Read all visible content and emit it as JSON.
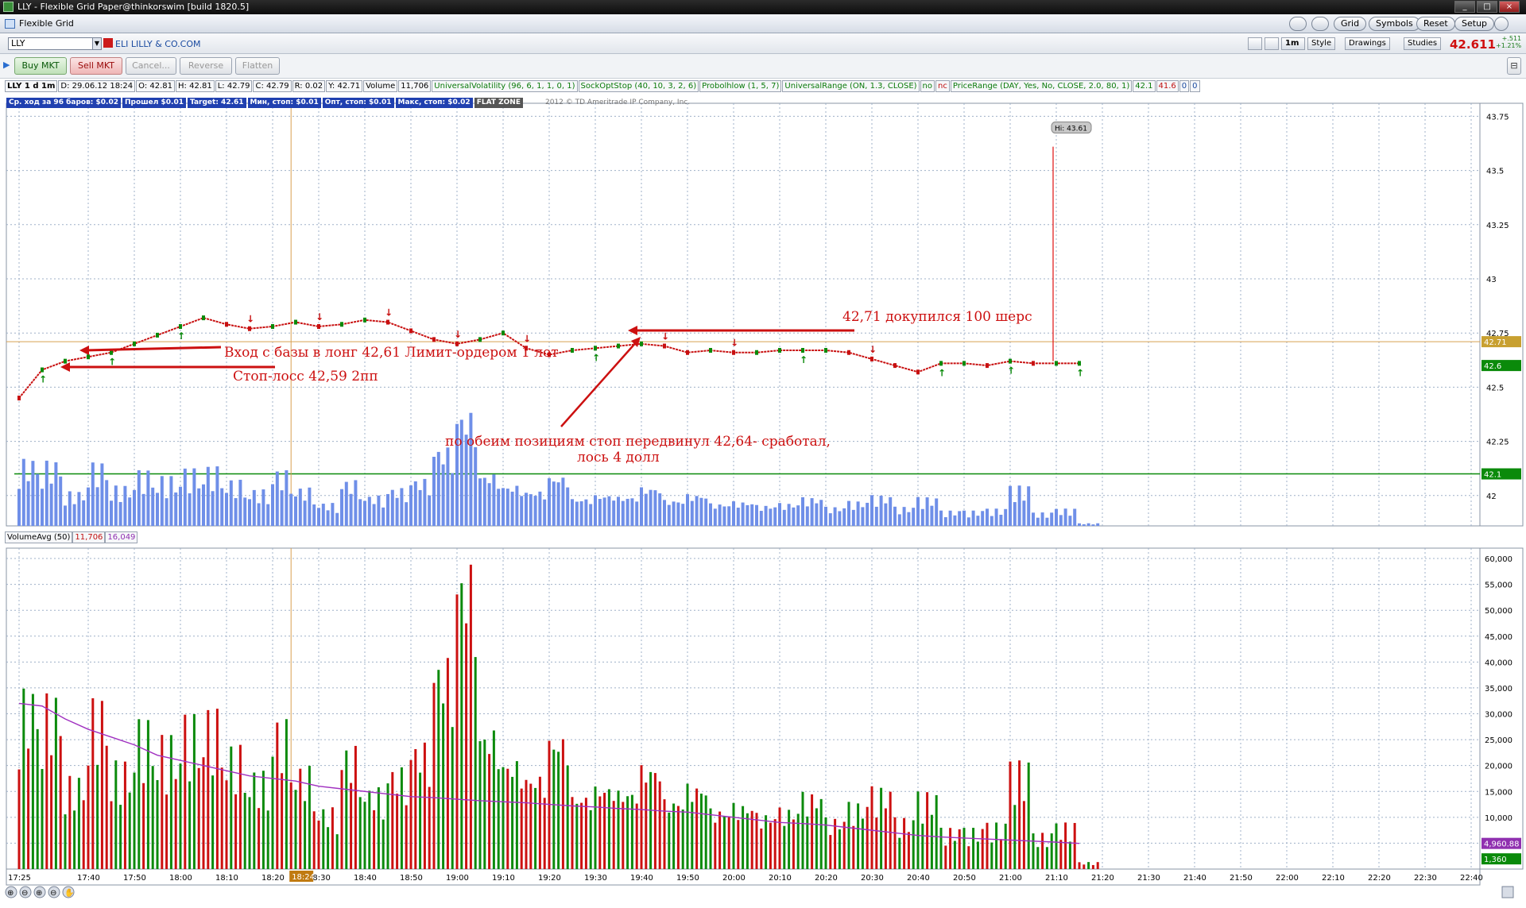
{
  "window": {
    "title": "LLY - Flexible Grid Paper@thinkorswim [build 1820.5]"
  },
  "menubar": {
    "tab_label": "Flexible Grid",
    "buttons": [
      "Grid",
      "Symbols",
      "Reset",
      "Setup"
    ]
  },
  "symbol_bar": {
    "symbol": "LLY",
    "company": "ELI LILLY & CO.COM",
    "timeframe": "1m",
    "tools": [
      "Style",
      "Drawings",
      "Studies"
    ],
    "last_price": "42.611",
    "change_top": "+.511",
    "change_bottom": "+1.21%"
  },
  "order_bar": {
    "buttons": [
      "Buy MKT",
      "Sell MKT",
      "Cancel...",
      "Reverse",
      "Flatten"
    ]
  },
  "legend": {
    "items": [
      "LLY 1 d 1m",
      "D: 29.06.12 18:24",
      "O: 42.81",
      "H: 42.81",
      "L: 42.79",
      "C: 42.79",
      "R: 0.02",
      "Y: 42.71",
      "Volume",
      "11,706",
      "UniversalVolatility (96, 6, 1, 1, 0, 1)",
      "SockOptStop (40, 10, 3, 2, 6)",
      "Probolhlow (1, 5, 7)",
      "UniversalRange (ON, 1.3, CLOSE)",
      "no",
      "nc",
      "PriceRange (DAY, Yes, No, CLOSE, 2.0, 80, 1)",
      "42.1",
      "41.6",
      "0",
      "0"
    ]
  },
  "stat_bar": {
    "items": [
      "Ср. ход за 96 баров: $0.02",
      "Прошел $0.01",
      "Target: 42.61",
      "Мин, стоп: $0.01",
      "Опт, стоп: $0.01",
      "Макс, стоп: $0.02"
    ],
    "flat_zone": "FLAT ZONE",
    "copyright": "2012 © TD Ameritrade IP Company, Inc."
  },
  "annotations": {
    "entry": "Вход с базы в лонг 42,61 Лимит-ордером 1 лот",
    "stop": "Стоп-лосс 42,59 2пп",
    "added": "42,71 докупился 100 шерс",
    "moved_stop_line1": "по обеим позициям стоп передвинул 42,64- сработал,",
    "moved_stop_line2": "лось 4 долл",
    "hi_label": "Hi: 43.61"
  },
  "price_axis": {
    "ticks": [
      "43.75",
      "43.5",
      "43.25",
      "43",
      "42.75",
      "42.5",
      "42.25",
      "42"
    ],
    "markers": {
      "line_4271": "42.71",
      "last": "42.6",
      "line_421": "42.1"
    }
  },
  "volume_legend": {
    "name": "VolumeAvg (50)",
    "volume": "11,706",
    "avg": "16,049"
  },
  "volume_axis": {
    "ticks": [
      "60,000",
      "55,000",
      "50,000",
      "45,000",
      "40,000",
      "35,000",
      "30,000",
      "25,000",
      "20,000",
      "15,000",
      "10,000",
      "5,000"
    ],
    "markers": {
      "avg": "4,960.88",
      "vol": "1,360"
    }
  },
  "time_axis": {
    "ticks": [
      "17:25",
      "17:40",
      "17:50",
      "18:00",
      "18:10",
      "18:20",
      "18:30",
      "18:40",
      "18:50",
      "19:00",
      "19:10",
      "19:20",
      "19:30",
      "19:40",
      "19:50",
      "20:00",
      "20:10",
      "20:20",
      "20:30",
      "20:40",
      "20:50",
      "21:00",
      "21:10",
      "21:20",
      "21:30",
      "21:40",
      "21:50",
      "22:00",
      "22:10",
      "22:20",
      "22:30",
      "22:40"
    ],
    "cursor": "18:24"
  },
  "chart_data": {
    "type": "line",
    "title": "LLY 1 d 1m",
    "price_series": {
      "name": "LLY",
      "x": [
        "17:25",
        "17:30",
        "17:35",
        "17:40",
        "17:45",
        "17:50",
        "17:55",
        "18:00",
        "18:05",
        "18:10",
        "18:15",
        "18:20",
        "18:25",
        "18:30",
        "18:35",
        "18:40",
        "18:45",
        "18:50",
        "18:55",
        "19:00",
        "19:05",
        "19:10",
        "19:15",
        "19:20",
        "19:25",
        "19:30",
        "19:35",
        "19:40",
        "19:45",
        "19:50",
        "19:55",
        "20:00",
        "20:05",
        "20:10",
        "20:15",
        "20:20",
        "20:25",
        "20:30",
        "20:35",
        "20:40",
        "20:45",
        "20:50",
        "20:55",
        "21:00",
        "21:05",
        "21:10",
        "21:15"
      ],
      "close": [
        42.45,
        42.58,
        42.62,
        42.64,
        42.66,
        42.7,
        42.74,
        42.78,
        42.82,
        42.79,
        42.77,
        42.78,
        42.8,
        42.78,
        42.79,
        42.81,
        42.8,
        42.76,
        42.72,
        42.7,
        42.72,
        42.75,
        42.68,
        42.65,
        42.67,
        42.68,
        42.69,
        42.7,
        42.69,
        42.66,
        42.67,
        42.66,
        42.66,
        42.67,
        42.67,
        42.67,
        42.66,
        42.63,
        42.6,
        42.57,
        42.61,
        42.61,
        42.6,
        42.62,
        42.61,
        42.61,
        42.61
      ]
    },
    "volume_series": {
      "name": "Volume",
      "x": [
        "17:25",
        "17:30",
        "17:35",
        "17:40",
        "17:45",
        "17:50",
        "17:55",
        "18:00",
        "18:05",
        "18:10",
        "18:15",
        "18:20",
        "18:25",
        "18:30",
        "18:35",
        "18:40",
        "18:45",
        "18:50",
        "18:55",
        "19:00",
        "19:05",
        "19:10",
        "19:15",
        "19:20",
        "19:25",
        "19:30",
        "19:35",
        "19:40",
        "19:45",
        "19:50",
        "19:55",
        "20:00",
        "20:05",
        "20:10",
        "20:15",
        "20:20",
        "20:25",
        "20:30",
        "20:35",
        "20:40",
        "20:45",
        "20:50",
        "20:55",
        "21:00",
        "21:05",
        "21:10",
        "21:15"
      ],
      "values": [
        35000,
        34000,
        18000,
        33000,
        21000,
        29000,
        26000,
        30000,
        31000,
        24000,
        19000,
        29000,
        20000,
        12000,
        24000,
        16000,
        20000,
        25000,
        42000,
        61000,
        28000,
        22000,
        19000,
        27000,
        15000,
        17000,
        16000,
        21000,
        14000,
        17000,
        12000,
        13000,
        11000,
        12000,
        15000,
        10000,
        13000,
        16000,
        10000,
        15000,
        8000,
        8000,
        9000,
        21000,
        7000,
        9000,
        1360
      ]
    },
    "volume_avg": {
      "name": "VolumeAvg (50)",
      "values": [
        32000,
        31500,
        29000,
        27000,
        25500,
        24000,
        22000,
        21000,
        20000,
        19000,
        18000,
        17500,
        17000,
        16000,
        15500,
        15000,
        14500,
        14000,
        13800,
        13500,
        13200,
        13000,
        12800,
        12500,
        12200,
        12000,
        11700,
        11500,
        11200,
        11000,
        10500,
        10000,
        9500,
        9000,
        8800,
        8500,
        8000,
        7500,
        7000,
        6500,
        6200,
        6000,
        5800,
        5600,
        5400,
        5200,
        4960.88
      ]
    },
    "y_price_range": [
      41.86,
      43.81
    ],
    "y_volume_range": [
      0,
      62000
    ],
    "reference_lines": [
      42.71,
      42.1
    ],
    "high_label": 43.61,
    "grid": true
  }
}
